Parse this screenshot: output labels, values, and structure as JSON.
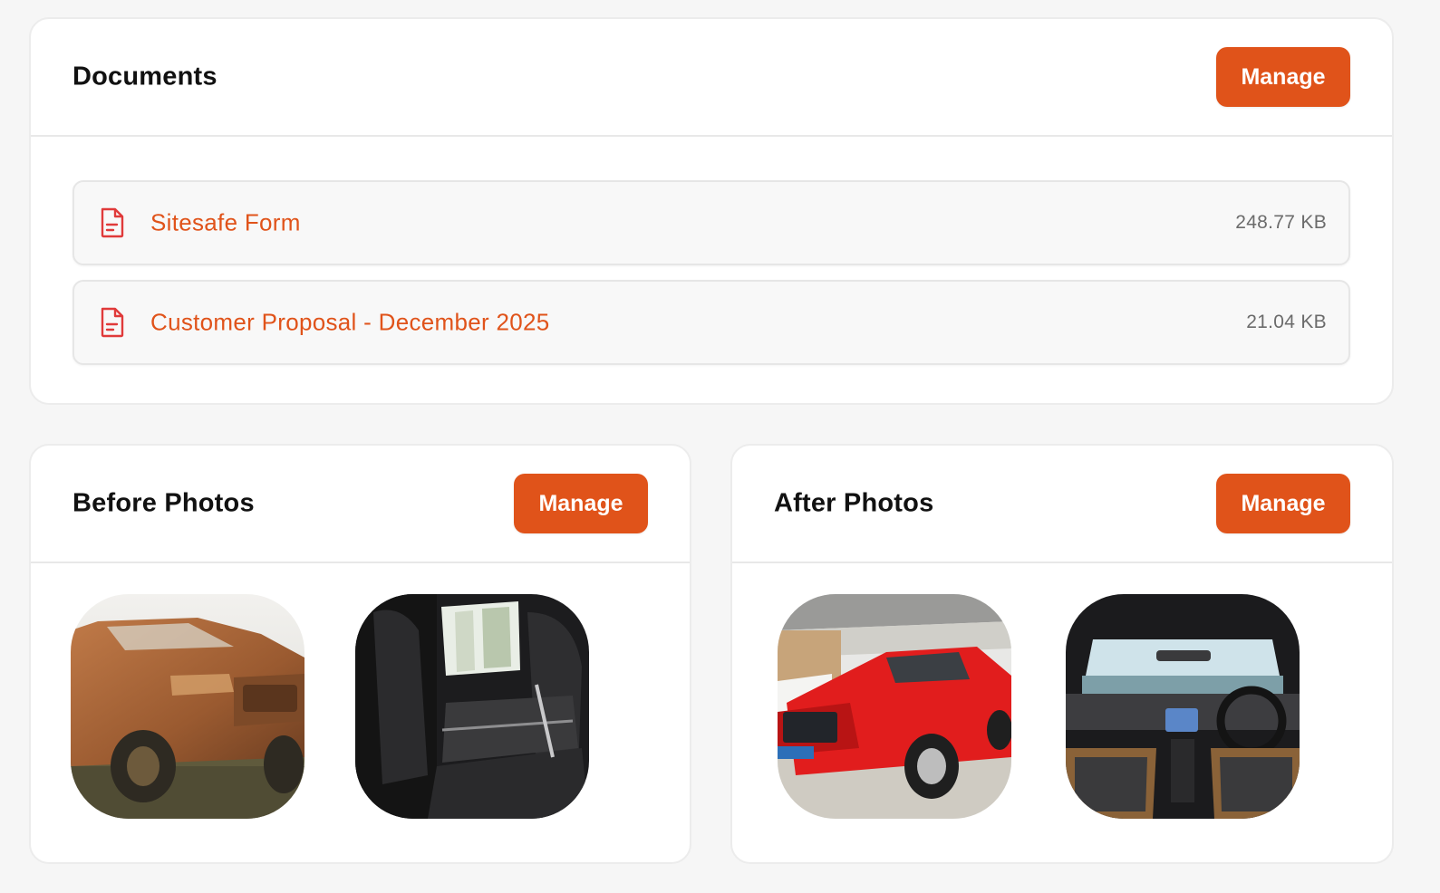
{
  "documents": {
    "title": "Documents",
    "manage_label": "Manage",
    "items": [
      {
        "name": "Sitesafe Form",
        "size": "248.77 KB",
        "icon": "file-icon"
      },
      {
        "name": "Customer Proposal - December 2025",
        "size": "21.04 KB",
        "icon": "file-icon"
      }
    ]
  },
  "before_photos": {
    "title": "Before Photos",
    "manage_label": "Manage",
    "photos": [
      "muddy-pickup-exterior",
      "rear-seat-interior"
    ]
  },
  "after_photos": {
    "title": "After Photos",
    "manage_label": "Manage",
    "photos": [
      "clean-red-pickup-exterior",
      "dashboard-interior"
    ]
  },
  "colors": {
    "accent": "#e0531a",
    "card_background": "#ffffff",
    "page_background": "#f6f6f6",
    "muted_text": "#6b6b6b"
  }
}
